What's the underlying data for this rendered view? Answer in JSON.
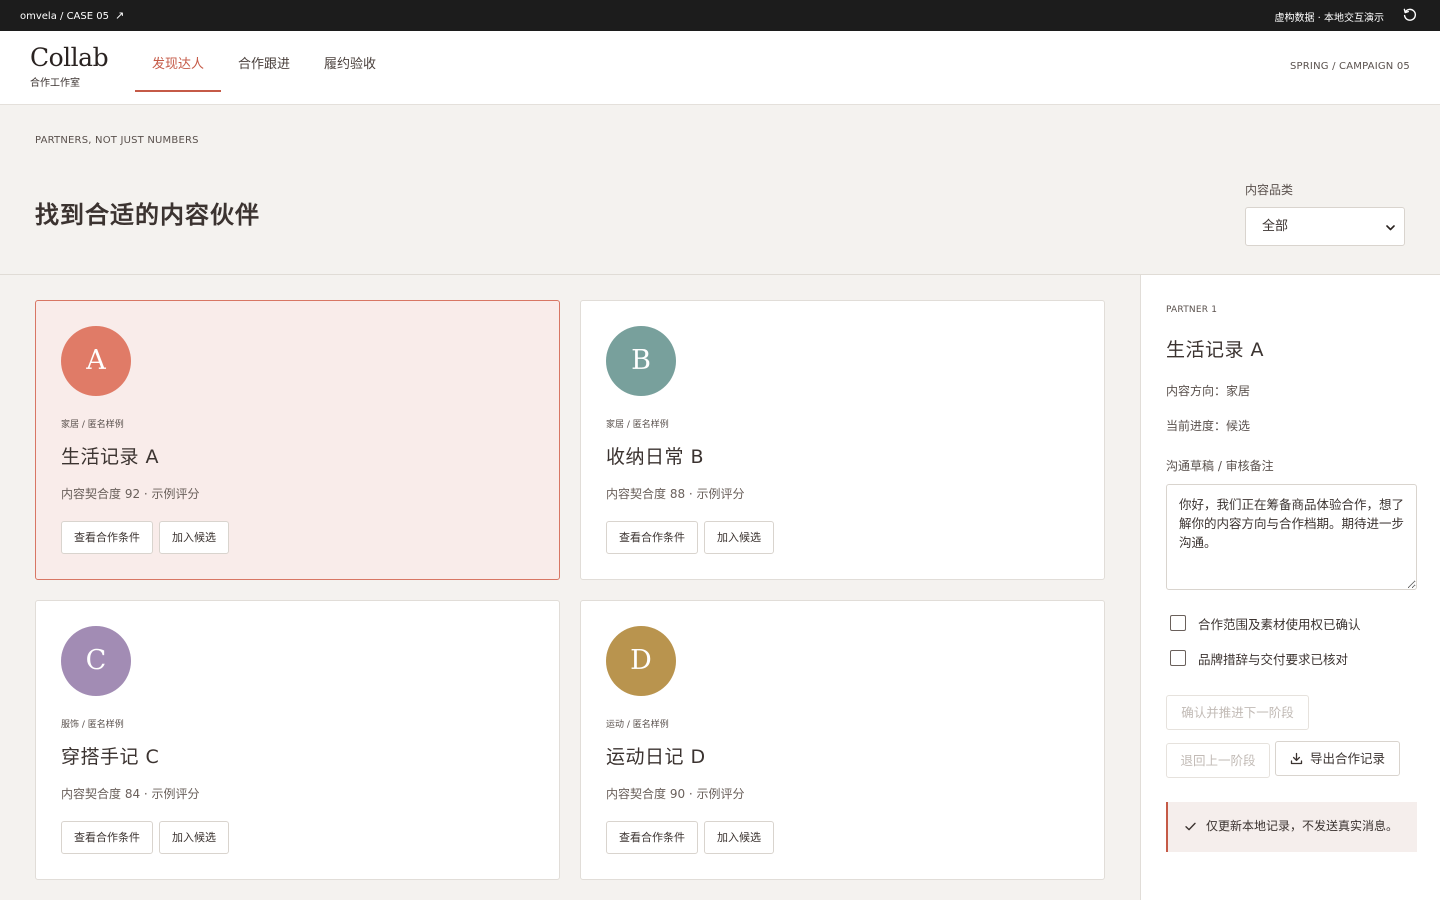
{
  "topbar": {
    "breadcrumb": "omvela / CASE 05",
    "open_icon": "arrow-up-right-icon",
    "demo_note": "虚构数据 · 本地交互演示",
    "reset_icon": "refresh-icon"
  },
  "header": {
    "logo": "Collab",
    "logo_sub": "合作工作室",
    "tabs": [
      {
        "label": "发现达人",
        "active": true
      },
      {
        "label": "合作跟进",
        "active": false
      },
      {
        "label": "履约验收",
        "active": false
      }
    ],
    "campaign": "SPRING / CAMPAIGN 05"
  },
  "hero": {
    "kicker": "PARTNERS, NOT JUST NUMBERS",
    "title": "找到合适的内容伙伴",
    "filter_label": "内容品类",
    "filter_value": "全部"
  },
  "cards": [
    {
      "initial": "A",
      "color": "#e07b67",
      "meta": "家居 / 匿名样例",
      "name": "生活记录 A",
      "score": "内容契合度 92 · 示例评分",
      "terms_label": "查看合作条件",
      "shortlist_label": "加入候选",
      "selected": true
    },
    {
      "initial": "B",
      "color": "#78a09c",
      "meta": "家居 / 匿名样例",
      "name": "收纳日常 B",
      "score": "内容契合度 88 · 示例评分",
      "terms_label": "查看合作条件",
      "shortlist_label": "加入候选",
      "selected": false
    },
    {
      "initial": "C",
      "color": "#a28cb4",
      "meta": "服饰 / 匿名样例",
      "name": "穿搭手记 C",
      "score": "内容契合度 84 · 示例评分",
      "terms_label": "查看合作条件",
      "shortlist_label": "加入候选",
      "selected": false
    },
    {
      "initial": "D",
      "color": "#b9944e",
      "meta": "运动 / 匿名样例",
      "name": "运动日记 D",
      "score": "内容契合度 90 · 示例评分",
      "terms_label": "查看合作条件",
      "shortlist_label": "加入候选",
      "selected": false
    }
  ],
  "panel": {
    "label": "PARTNER 1",
    "title": "生活记录 A",
    "direction": "内容方向：家居",
    "progress": "当前进度：候选",
    "notes_label": "沟通草稿 / 审核备注",
    "notes_value": "你好，我们正在筹备商品体验合作，想了解你的内容方向与合作档期。期待进一步沟通。",
    "checks": [
      {
        "label": "合作范围及素材使用权已确认",
        "checked": false
      },
      {
        "label": "品牌措辞与交付要求已核对",
        "checked": false
      }
    ],
    "confirm_label": "确认并推进下一阶段",
    "back_label": "退回上一阶段",
    "export_label": "导出合作记录",
    "notice": "仅更新本地记录，不发送真实消息。"
  }
}
